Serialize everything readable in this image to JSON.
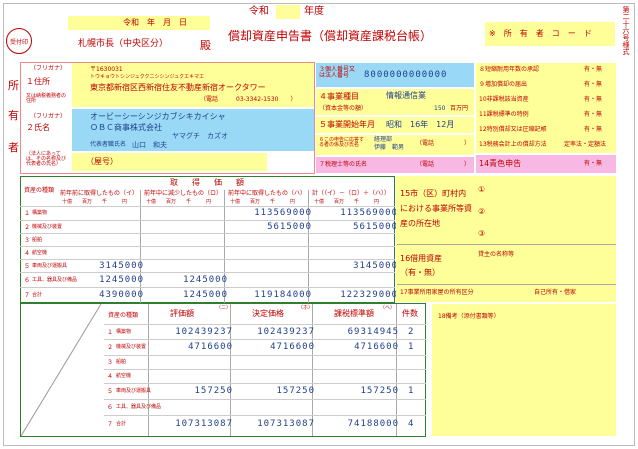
{
  "header": {
    "era_date": "令和　年　月　日",
    "era": "令和",
    "year_label": "年度",
    "title": "償却資産申告書（償却資産課税台帳）",
    "stamp": "受付印",
    "addressee": "札幌市長（中央区分）",
    "honorific": "殿",
    "owner_code_label": "※　所　有　者　コ　ー　ド",
    "side_label": "第二十六号様式"
  },
  "owner": {
    "side_char": [
      "所",
      "有",
      "者"
    ],
    "address_label": "１住所",
    "furigana_label": "（フリガナ）",
    "address_sub_label": "又は納税義務者の住所",
    "postal": "〒1630031",
    "address_kana": "トウキョウトシンジュククニシシンジュクエキマエ",
    "address": "東京都新宿区西新宿住友不動産新宿オークタワー",
    "phone": "（電話　　　03-3342-1530　　）",
    "name_label": "２氏名",
    "name_sub_label": "（法人にあっては、その名称及び代表者の氏名）",
    "name_kana": "オービーシーシンジカブシキカイシャ",
    "name": "ＯＢＣ商事株式会社",
    "rep_kana": "ヤマグチ　カズオ",
    "rep_label": "代表者職氏名",
    "rep_name": "山口　和夫",
    "trade_name": "（屋号）"
  },
  "right_info": {
    "corp_no_label": "３個人番号又は法人番号",
    "corp_no": "8000000000000",
    "business_label": "４事業種目",
    "business": "情報通信業",
    "capital_label": "（資本金等の額）",
    "capital": "150",
    "capital_unit": "百万円",
    "start_label": "５事業開始年月",
    "start": "昭和　16年　12月",
    "contact_label": "６この申告に応答する者の係及び氏名",
    "contact_dept": "経理部",
    "contact_name": "伊藤　範男",
    "contact_phone": "（電話　　　　　）",
    "tax_acct_label": "７税理士等の氏名",
    "tax_acct_phone": "（電話　　　　　）"
  },
  "checklist": [
    {
      "label": "８短縮耐用年数の承認",
      "val": "有・無"
    },
    {
      "label": "９増加償却の届出",
      "val": "有・無"
    },
    {
      "label": "10非課税該当資産",
      "val": "有・無"
    },
    {
      "label": "11課税標準の特例",
      "val": "有・無"
    },
    {
      "label": "12特別償却又は圧縮記帳",
      "val": "有・無"
    },
    {
      "label": "13税務会計上の償却方法",
      "val": "定率法・定額法"
    },
    {
      "label": "14青色申告",
      "val": "有・無"
    }
  ],
  "table1": {
    "title_cols": [
      "取得価額"
    ],
    "headers": [
      "前年前に取得したもの（イ）",
      "前年中に減少したもの（ロ）",
      "前年中に取得したもの（ハ）",
      "計（（イ）－（ロ）＋（ハ））"
    ],
    "units": [
      "十億",
      "百万",
      "千",
      "円"
    ],
    "row_header": "資産の種類",
    "rows": [
      {
        "no": "１",
        "name": "構築物",
        "a": "",
        "b": "",
        "c": "113569000",
        "d": "113569000"
      },
      {
        "no": "２",
        "name": "機械及び装置",
        "a": "",
        "b": "",
        "c": "5615000",
        "d": "5615000"
      },
      {
        "no": "３",
        "name": "船舶",
        "a": "",
        "b": "",
        "c": "",
        "d": ""
      },
      {
        "no": "４",
        "name": "航空機",
        "a": "",
        "b": "",
        "c": "",
        "d": ""
      },
      {
        "no": "５",
        "name": "車両及び運搬具",
        "a": "3145000",
        "b": "",
        "c": "",
        "d": "3145000"
      },
      {
        "no": "６",
        "name": "工具、器具及び備品",
        "a": "1245000",
        "b": "1245000",
        "c": "",
        "d": ""
      },
      {
        "no": "７",
        "name": "合計",
        "a": "4390000",
        "b": "1245000",
        "c": "119184000",
        "d": "122329000"
      }
    ]
  },
  "right_lower": {
    "location_label": "15市（区）町村内における事業所等資産の所在地",
    "loc1": "①",
    "loc2": "②",
    "loc3": "③",
    "lease_label": "16借用資産（有・無）",
    "lessor_label": "貸主の名称等",
    "owner_class_label": "17事業所用家屋の所有区分",
    "owner_class_val": "自己所有・借家",
    "remarks_label": "18備考（添付書類等）"
  },
  "table2": {
    "headers": [
      "評価額",
      "決定価格",
      "課税標準額",
      "件数"
    ],
    "header_tags": [
      "（ニ）",
      "（ホ）",
      "（ヘ）"
    ],
    "row_header": "資産の種類",
    "rows": [
      {
        "no": "１",
        "name": "構築物",
        "a": "102439237",
        "b": "102439237",
        "c": "69314945",
        "d": "2"
      },
      {
        "no": "２",
        "name": "機械及び装置",
        "a": "4716600",
        "b": "4716600",
        "c": "4716600",
        "d": "1"
      },
      {
        "no": "３",
        "name": "船舶",
        "a": "",
        "b": "",
        "c": "",
        "d": ""
      },
      {
        "no": "４",
        "name": "航空機",
        "a": "",
        "b": "",
        "c": "",
        "d": ""
      },
      {
        "no": "５",
        "name": "車両及び運搬具",
        "a": "157250",
        "b": "157250",
        "c": "157250",
        "d": "1"
      },
      {
        "no": "６",
        "name": "工具、器具及び備品",
        "a": "",
        "b": "",
        "c": "",
        "d": ""
      },
      {
        "no": "７",
        "name": "合計",
        "a": "107313087",
        "b": "107313087",
        "c": "74188000",
        "d": "4"
      }
    ]
  }
}
